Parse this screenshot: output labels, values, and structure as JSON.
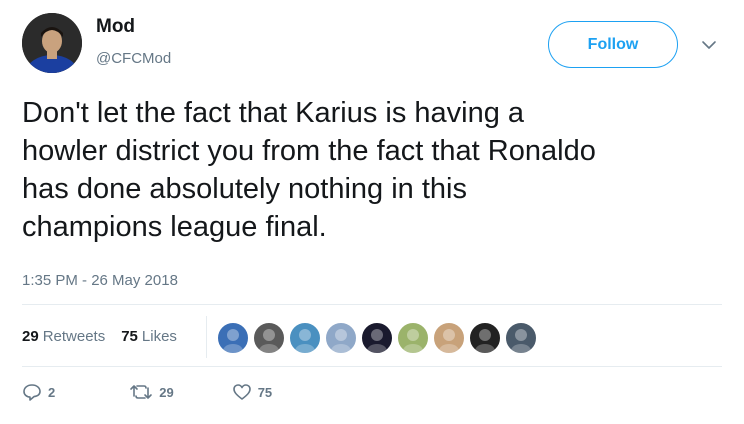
{
  "user": {
    "display_name": "Mod",
    "handle": "@CFCMod"
  },
  "follow_label": "Follow",
  "tweet": {
    "text": "Don't let the fact that Karius is having a\nhowler district you from the fact that Ronaldo\nhas done absolutely nothing in this\nchampions league final.",
    "timestamp": "1:35 PM - 26 May 2018"
  },
  "stats": {
    "retweets_count": "29",
    "retweets_label": "Retweets",
    "likes_count": "75",
    "likes_label": "Likes"
  },
  "likers": [
    {
      "color": "#3b6fb6"
    },
    {
      "color": "#5a5a5a"
    },
    {
      "color": "#4a90c0"
    },
    {
      "color": "#8fa8c8"
    },
    {
      "color": "#1a1a2e"
    },
    {
      "color": "#9bb36b"
    },
    {
      "color": "#c8a27a"
    },
    {
      "color": "#222222"
    },
    {
      "color": "#4a5a6a"
    }
  ],
  "actions": {
    "replies": "2",
    "retweets": "29",
    "likes": "75"
  },
  "colors": {
    "accent": "#1da1f2",
    "muted": "#657786",
    "text": "#14171a",
    "divider": "#e6ecf0"
  }
}
